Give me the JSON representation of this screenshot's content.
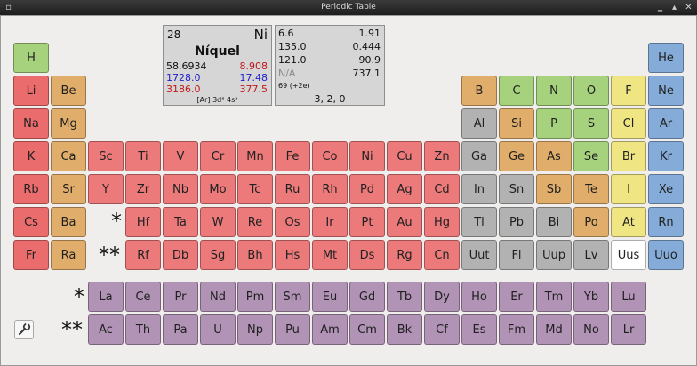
{
  "window": {
    "title": "Periodic Table",
    "min_icon": "minimize-icon",
    "max_icon": "maximize-icon",
    "close_icon": "close-icon"
  },
  "colors": {
    "alkali": "#ea6c6c",
    "alkaline": "#e0ad6a",
    "transition": "#ec7a7a",
    "nonmetal": "#a6d27e",
    "halogen": "#f0e583",
    "noble": "#85acd8",
    "metalloid": "#e0ad6a",
    "post": "#b2b2b2",
    "lanth": "#b193b6",
    "white": "#ffffff"
  },
  "elements": [
    {
      "s": "H",
      "c": "nonmetal",
      "col": 1,
      "row": 1
    },
    {
      "s": "He",
      "c": "noble",
      "col": 18,
      "row": 1
    },
    {
      "s": "Li",
      "c": "alkali",
      "col": 1,
      "row": 2
    },
    {
      "s": "Be",
      "c": "alkaline",
      "col": 2,
      "row": 2
    },
    {
      "s": "B",
      "c": "metalloid",
      "col": 13,
      "row": 2
    },
    {
      "s": "C",
      "c": "nonmetal",
      "col": 14,
      "row": 2
    },
    {
      "s": "N",
      "c": "nonmetal",
      "col": 15,
      "row": 2
    },
    {
      "s": "O",
      "c": "nonmetal",
      "col": 16,
      "row": 2
    },
    {
      "s": "F",
      "c": "halogen",
      "col": 17,
      "row": 2
    },
    {
      "s": "Ne",
      "c": "noble",
      "col": 18,
      "row": 2
    },
    {
      "s": "Na",
      "c": "alkali",
      "col": 1,
      "row": 3
    },
    {
      "s": "Mg",
      "c": "alkaline",
      "col": 2,
      "row": 3
    },
    {
      "s": "Al",
      "c": "post",
      "col": 13,
      "row": 3
    },
    {
      "s": "Si",
      "c": "metalloid",
      "col": 14,
      "row": 3
    },
    {
      "s": "P",
      "c": "nonmetal",
      "col": 15,
      "row": 3
    },
    {
      "s": "S",
      "c": "nonmetal",
      "col": 16,
      "row": 3
    },
    {
      "s": "Cl",
      "c": "halogen",
      "col": 17,
      "row": 3
    },
    {
      "s": "Ar",
      "c": "noble",
      "col": 18,
      "row": 3
    },
    {
      "s": "K",
      "c": "alkali",
      "col": 1,
      "row": 4
    },
    {
      "s": "Ca",
      "c": "alkaline",
      "col": 2,
      "row": 4
    },
    {
      "s": "Sc",
      "c": "transition",
      "col": 3,
      "row": 4
    },
    {
      "s": "Ti",
      "c": "transition",
      "col": 4,
      "row": 4
    },
    {
      "s": "V",
      "c": "transition",
      "col": 5,
      "row": 4
    },
    {
      "s": "Cr",
      "c": "transition",
      "col": 6,
      "row": 4
    },
    {
      "s": "Mn",
      "c": "transition",
      "col": 7,
      "row": 4
    },
    {
      "s": "Fe",
      "c": "transition",
      "col": 8,
      "row": 4
    },
    {
      "s": "Co",
      "c": "transition",
      "col": 9,
      "row": 4
    },
    {
      "s": "Ni",
      "c": "transition",
      "col": 10,
      "row": 4
    },
    {
      "s": "Cu",
      "c": "transition",
      "col": 11,
      "row": 4
    },
    {
      "s": "Zn",
      "c": "transition",
      "col": 12,
      "row": 4
    },
    {
      "s": "Ga",
      "c": "post",
      "col": 13,
      "row": 4
    },
    {
      "s": "Ge",
      "c": "metalloid",
      "col": 14,
      "row": 4
    },
    {
      "s": "As",
      "c": "metalloid",
      "col": 15,
      "row": 4
    },
    {
      "s": "Se",
      "c": "nonmetal",
      "col": 16,
      "row": 4
    },
    {
      "s": "Br",
      "c": "halogen",
      "col": 17,
      "row": 4
    },
    {
      "s": "Kr",
      "c": "noble",
      "col": 18,
      "row": 4
    },
    {
      "s": "Rb",
      "c": "alkali",
      "col": 1,
      "row": 5
    },
    {
      "s": "Sr",
      "c": "alkaline",
      "col": 2,
      "row": 5
    },
    {
      "s": "Y",
      "c": "transition",
      "col": 3,
      "row": 5
    },
    {
      "s": "Zr",
      "c": "transition",
      "col": 4,
      "row": 5
    },
    {
      "s": "Nb",
      "c": "transition",
      "col": 5,
      "row": 5
    },
    {
      "s": "Mo",
      "c": "transition",
      "col": 6,
      "row": 5
    },
    {
      "s": "Tc",
      "c": "transition",
      "col": 7,
      "row": 5
    },
    {
      "s": "Ru",
      "c": "transition",
      "col": 8,
      "row": 5
    },
    {
      "s": "Rh",
      "c": "transition",
      "col": 9,
      "row": 5
    },
    {
      "s": "Pd",
      "c": "transition",
      "col": 10,
      "row": 5
    },
    {
      "s": "Ag",
      "c": "transition",
      "col": 11,
      "row": 5
    },
    {
      "s": "Cd",
      "c": "transition",
      "col": 12,
      "row": 5
    },
    {
      "s": "In",
      "c": "post",
      "col": 13,
      "row": 5
    },
    {
      "s": "Sn",
      "c": "post",
      "col": 14,
      "row": 5
    },
    {
      "s": "Sb",
      "c": "metalloid",
      "col": 15,
      "row": 5
    },
    {
      "s": "Te",
      "c": "metalloid",
      "col": 16,
      "row": 5
    },
    {
      "s": "I",
      "c": "halogen",
      "col": 17,
      "row": 5
    },
    {
      "s": "Xe",
      "c": "noble",
      "col": 18,
      "row": 5
    },
    {
      "s": "Cs",
      "c": "alkali",
      "col": 1,
      "row": 6
    },
    {
      "s": "Ba",
      "c": "alkaline",
      "col": 2,
      "row": 6
    },
    {
      "s": "Hf",
      "c": "transition",
      "col": 4,
      "row": 6
    },
    {
      "s": "Ta",
      "c": "transition",
      "col": 5,
      "row": 6
    },
    {
      "s": "W",
      "c": "transition",
      "col": 6,
      "row": 6
    },
    {
      "s": "Re",
      "c": "transition",
      "col": 7,
      "row": 6
    },
    {
      "s": "Os",
      "c": "transition",
      "col": 8,
      "row": 6
    },
    {
      "s": "Ir",
      "c": "transition",
      "col": 9,
      "row": 6
    },
    {
      "s": "Pt",
      "c": "transition",
      "col": 10,
      "row": 6
    },
    {
      "s": "Au",
      "c": "transition",
      "col": 11,
      "row": 6
    },
    {
      "s": "Hg",
      "c": "transition",
      "col": 12,
      "row": 6
    },
    {
      "s": "Tl",
      "c": "post",
      "col": 13,
      "row": 6
    },
    {
      "s": "Pb",
      "c": "post",
      "col": 14,
      "row": 6
    },
    {
      "s": "Bi",
      "c": "post",
      "col": 15,
      "row": 6
    },
    {
      "s": "Po",
      "c": "metalloid",
      "col": 16,
      "row": 6
    },
    {
      "s": "At",
      "c": "halogen",
      "col": 17,
      "row": 6
    },
    {
      "s": "Rn",
      "c": "noble",
      "col": 18,
      "row": 6
    },
    {
      "s": "Fr",
      "c": "alkali",
      "col": 1,
      "row": 7
    },
    {
      "s": "Ra",
      "c": "alkaline",
      "col": 2,
      "row": 7
    },
    {
      "s": "Rf",
      "c": "transition",
      "col": 4,
      "row": 7
    },
    {
      "s": "Db",
      "c": "transition",
      "col": 5,
      "row": 7
    },
    {
      "s": "Sg",
      "c": "transition",
      "col": 6,
      "row": 7
    },
    {
      "s": "Bh",
      "c": "transition",
      "col": 7,
      "row": 7
    },
    {
      "s": "Hs",
      "c": "transition",
      "col": 8,
      "row": 7
    },
    {
      "s": "Mt",
      "c": "transition",
      "col": 9,
      "row": 7
    },
    {
      "s": "Ds",
      "c": "transition",
      "col": 10,
      "row": 7
    },
    {
      "s": "Rg",
      "c": "transition",
      "col": 11,
      "row": 7
    },
    {
      "s": "Cn",
      "c": "transition",
      "col": 12,
      "row": 7
    },
    {
      "s": "Uut",
      "c": "post",
      "col": 13,
      "row": 7
    },
    {
      "s": "Fl",
      "c": "post",
      "col": 14,
      "row": 7
    },
    {
      "s": "Uup",
      "c": "post",
      "col": 15,
      "row": 7
    },
    {
      "s": "Lv",
      "c": "post",
      "col": 16,
      "row": 7
    },
    {
      "s": "Uus",
      "c": "white",
      "col": 17,
      "row": 7
    },
    {
      "s": "Uuo",
      "c": "noble",
      "col": 18,
      "row": 7
    },
    {
      "s": "La",
      "c": "lanth",
      "col": 3,
      "row": 8
    },
    {
      "s": "Ce",
      "c": "lanth",
      "col": 4,
      "row": 8
    },
    {
      "s": "Pr",
      "c": "lanth",
      "col": 5,
      "row": 8
    },
    {
      "s": "Nd",
      "c": "lanth",
      "col": 6,
      "row": 8
    },
    {
      "s": "Pm",
      "c": "lanth",
      "col": 7,
      "row": 8
    },
    {
      "s": "Sm",
      "c": "lanth",
      "col": 8,
      "row": 8
    },
    {
      "s": "Eu",
      "c": "lanth",
      "col": 9,
      "row": 8
    },
    {
      "s": "Gd",
      "c": "lanth",
      "col": 10,
      "row": 8
    },
    {
      "s": "Tb",
      "c": "lanth",
      "col": 11,
      "row": 8
    },
    {
      "s": "Dy",
      "c": "lanth",
      "col": 12,
      "row": 8
    },
    {
      "s": "Ho",
      "c": "lanth",
      "col": 13,
      "row": 8
    },
    {
      "s": "Er",
      "c": "lanth",
      "col": 14,
      "row": 8
    },
    {
      "s": "Tm",
      "c": "lanth",
      "col": 15,
      "row": 8
    },
    {
      "s": "Yb",
      "c": "lanth",
      "col": 16,
      "row": 8
    },
    {
      "s": "Lu",
      "c": "lanth",
      "col": 17,
      "row": 8
    },
    {
      "s": "Ac",
      "c": "lanth",
      "col": 3,
      "row": 9
    },
    {
      "s": "Th",
      "c": "lanth",
      "col": 4,
      "row": 9
    },
    {
      "s": "Pa",
      "c": "lanth",
      "col": 5,
      "row": 9
    },
    {
      "s": "U",
      "c": "lanth",
      "col": 6,
      "row": 9
    },
    {
      "s": "Np",
      "c": "lanth",
      "col": 7,
      "row": 9
    },
    {
      "s": "Pu",
      "c": "lanth",
      "col": 8,
      "row": 9
    },
    {
      "s": "Am",
      "c": "lanth",
      "col": 9,
      "row": 9
    },
    {
      "s": "Cm",
      "c": "lanth",
      "col": 10,
      "row": 9
    },
    {
      "s": "Bk",
      "c": "lanth",
      "col": 11,
      "row": 9
    },
    {
      "s": "Cf",
      "c": "lanth",
      "col": 12,
      "row": 9
    },
    {
      "s": "Es",
      "c": "lanth",
      "col": 13,
      "row": 9
    },
    {
      "s": "Fm",
      "c": "lanth",
      "col": 14,
      "row": 9
    },
    {
      "s": "Md",
      "c": "lanth",
      "col": 15,
      "row": 9
    },
    {
      "s": "No",
      "c": "lanth",
      "col": 16,
      "row": 9
    },
    {
      "s": "Lr",
      "c": "lanth",
      "col": 17,
      "row": 9
    }
  ],
  "markers": {
    "single": "*",
    "double": "**"
  },
  "detail": {
    "number": "28",
    "symbol": "Ni",
    "name": "Níquel",
    "mass": "58.6934",
    "density": "8.908",
    "melting": "1728.0",
    "electronegativity_right": "17.48",
    "boiling": "3186.0",
    "heat": "377.5",
    "config": "[Ar] 3d⁸ 4s²"
  },
  "props": {
    "r1_left": "6.6",
    "r1_right": "1.91",
    "r2_left": "135.0",
    "r2_right": "0.444",
    "r3_left": "121.0",
    "r3_right": "90.9",
    "r4_left": "N/A",
    "r4_right": "737.1",
    "ion": "69 (+2e)",
    "oxidation": "3, 2, 0"
  },
  "tool": {
    "icon": "wrench-icon"
  }
}
